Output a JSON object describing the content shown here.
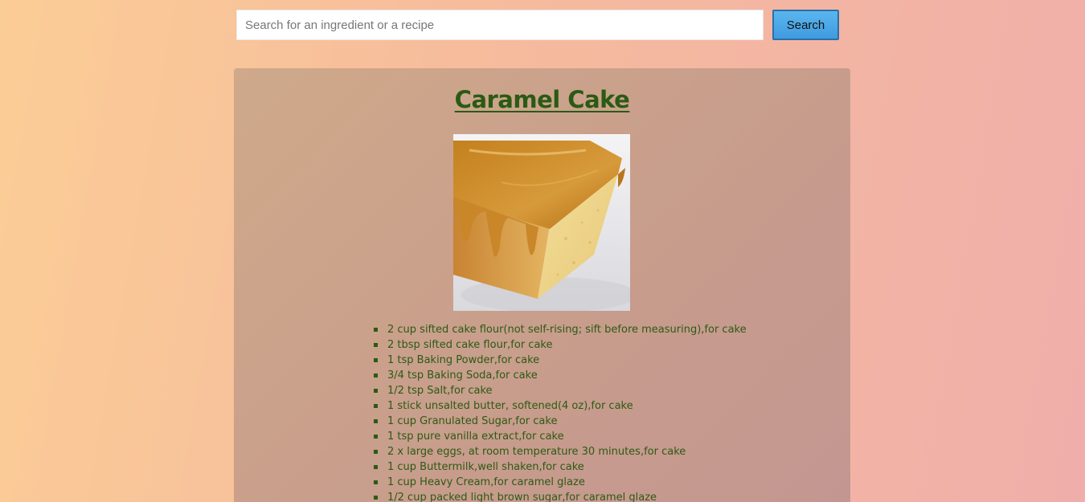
{
  "search": {
    "placeholder": "Search for an ingredient or a recipe",
    "value": "",
    "button_label": "Search"
  },
  "recipe": {
    "title": "Caramel Cake",
    "image": "caramel-cake-slice",
    "ingredients": [
      "2 cup sifted cake flour(not self-rising; sift before measuring),for cake",
      "2 tbsp sifted cake flour,for cake",
      "1 tsp Baking Powder,for cake",
      "3/4 tsp Baking Soda,for cake",
      "1/2 tsp Salt,for cake",
      "1 stick unsalted butter, softened(4 oz),for cake",
      "1 cup Granulated Sugar,for cake",
      "1 tsp pure vanilla extract,for cake",
      "2 x large eggs, at room temperature 30 minutes,for cake",
      "1 cup Buttermilk,well shaken,for cake",
      "1 cup Heavy Cream,for caramel glaze",
      "1/2 cup packed light brown sugar,for caramel glaze"
    ]
  },
  "colors": {
    "title": "#2a5a14",
    "ingredient_text": "#2d5a14",
    "search_button": "#4aa8ea",
    "card_background": "#c9a08c"
  }
}
